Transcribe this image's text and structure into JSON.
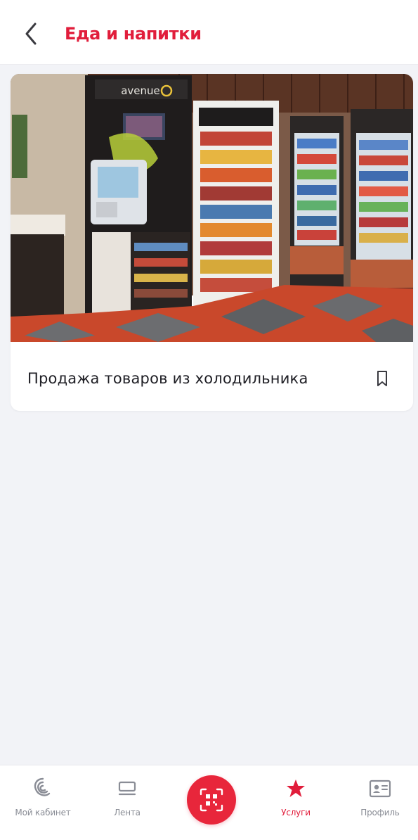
{
  "header": {
    "title": "Еда и напитки",
    "back_icon": "chevron-left-icon"
  },
  "card": {
    "image_description": "micro-market-photo",
    "title": "Продажа товаров из холодильника",
    "bookmark_icon": "bookmark-icon",
    "kiosk_brand": "avenue"
  },
  "bottom_nav": {
    "items": [
      {
        "label": "Мой кабинет",
        "icon": "cabinet-logo-icon",
        "active": false
      },
      {
        "label": "Лента",
        "icon": "feed-icon",
        "active": false
      },
      {
        "label": "",
        "icon": "qr-scan-icon",
        "active": false
      },
      {
        "label": "Услуги",
        "icon": "star-icon",
        "active": true
      },
      {
        "label": "Профиль",
        "icon": "profile-card-icon",
        "active": false
      }
    ]
  },
  "colors": {
    "accent": "#e11d3b",
    "background": "#f2f3f7",
    "text": "#1e1e24",
    "inactive": "#8a8d96"
  }
}
